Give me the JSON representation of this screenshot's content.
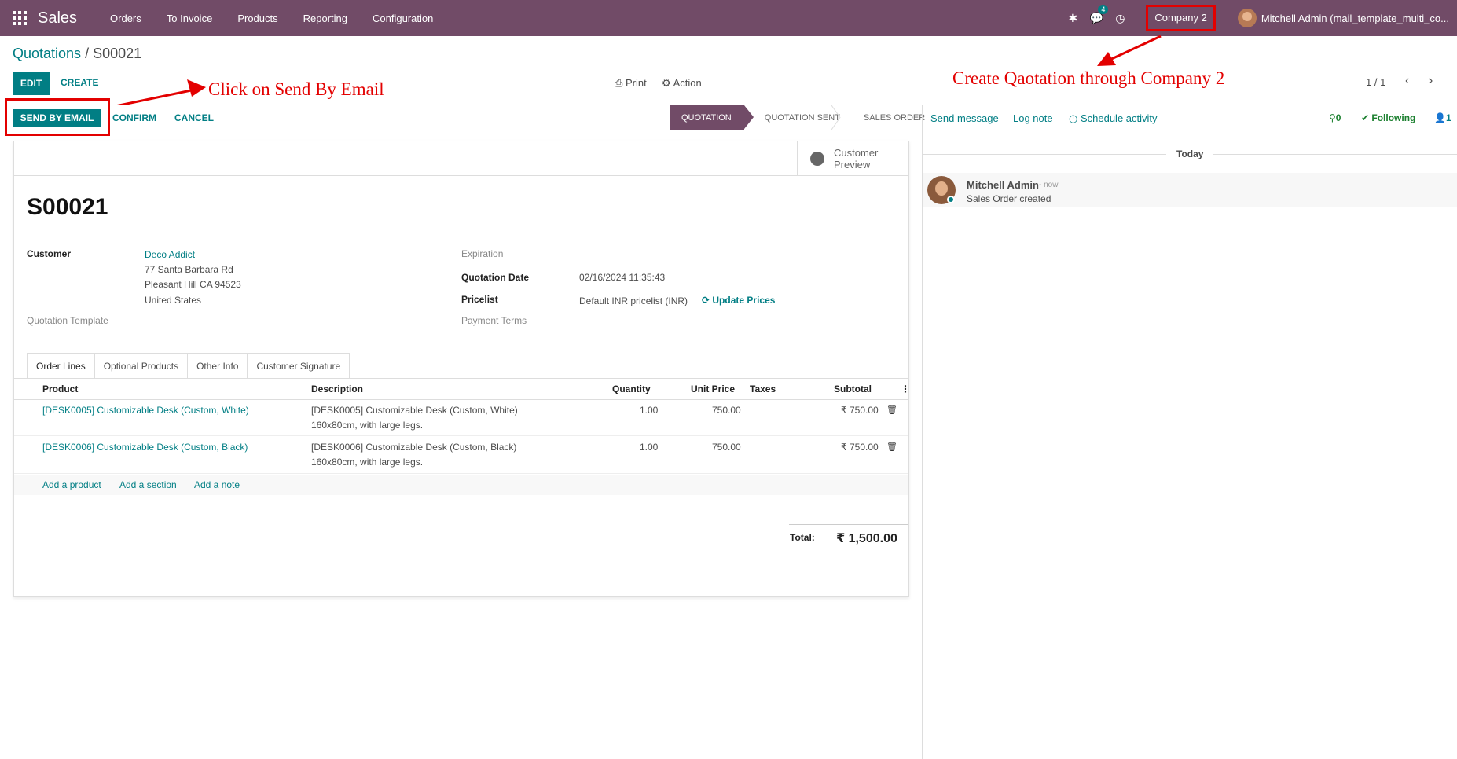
{
  "topbar": {
    "app_name": "Sales",
    "menu": [
      "Orders",
      "To Invoice",
      "Products",
      "Reporting",
      "Configuration"
    ],
    "messages_badge": "4",
    "company": "Company 2",
    "user": "Mitchell Admin (mail_template_multi_co..."
  },
  "breadcrumb": {
    "parent": "Quotations",
    "separator": " / ",
    "current": "S00021"
  },
  "control": {
    "edit": "EDIT",
    "create": "CREATE",
    "print": "Print",
    "action": "Action",
    "pager": "1 / 1",
    "prev": "‹",
    "next": "›"
  },
  "annotations": {
    "send_email": "Click on Send By Email",
    "company": "Create Qaotation through Company 2"
  },
  "statusbar": {
    "send_by_email": "SEND BY EMAIL",
    "confirm": "CONFIRM",
    "cancel": "CANCEL",
    "stages": [
      "QUOTATION",
      "QUOTATION SENT",
      "SALES ORDER"
    ],
    "active_stage": "QUOTATION"
  },
  "form": {
    "customer_preview": "Customer Preview",
    "name": "S00021",
    "customer_label": "Customer",
    "customer_name": "Deco Addict",
    "address": [
      "77 Santa Barbara Rd",
      "Pleasant Hill CA 94523",
      "United States"
    ],
    "quotation_template_label": "Quotation Template",
    "expiration_label": "Expiration",
    "quotation_date_label": "Quotation Date",
    "quotation_date": "02/16/2024 11:35:43",
    "pricelist_label": "Pricelist",
    "pricelist": "Default INR pricelist (INR)",
    "update_prices": "Update Prices",
    "payment_terms_label": "Payment Terms"
  },
  "tabs": [
    "Order Lines",
    "Optional Products",
    "Other Info",
    "Customer Signature"
  ],
  "order_lines": {
    "headers": [
      "Product",
      "Description",
      "Quantity",
      "Unit Price",
      "Taxes",
      "Subtotal"
    ],
    "rows": [
      {
        "product": "[DESK0005] Customizable Desk (Custom, White)",
        "desc1": "[DESK0005] Customizable Desk (Custom, White)",
        "desc2": "160x80cm, with large legs.",
        "qty": "1.00",
        "price": "750.00",
        "taxes": "",
        "subtotal": "₹ 750.00"
      },
      {
        "product": "[DESK0006] Customizable Desk (Custom, Black)",
        "desc1": "[DESK0006] Customizable Desk (Custom, Black)",
        "desc2": "160x80cm, with large legs.",
        "qty": "1.00",
        "price": "750.00",
        "taxes": "",
        "subtotal": "₹ 750.00"
      }
    ],
    "add_product": "Add a product",
    "add_section": "Add a section",
    "add_note": "Add a note",
    "total_label": "Total:",
    "total": "₹ 1,500.00"
  },
  "chatter": {
    "send_message": "Send message",
    "log_note": "Log note",
    "schedule_activity": "Schedule activity",
    "attachments": "0",
    "following": "Following",
    "followers": "1",
    "today": "Today",
    "message": {
      "author": "Mitchell Admin",
      "time": "- now",
      "body": "Sales Order created"
    }
  }
}
